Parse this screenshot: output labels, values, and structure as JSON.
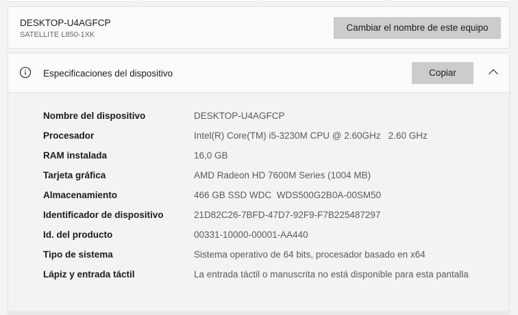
{
  "device": {
    "name": "DESKTOP-U4AGFCP",
    "model": "SATELLITE L850-1XK",
    "rename_label": "Cambiar el nombre de este equipo"
  },
  "specs": {
    "title": "Especificaciones del dispositivo",
    "copy_label": "Copiar",
    "info_icon": "info-icon",
    "collapse_icon": "chevron-up-icon",
    "rows": [
      {
        "label": "Nombre del dispositivo",
        "value": "DESKTOP-U4AGFCP"
      },
      {
        "label": "Procesador",
        "value": "Intel(R) Core(TM) i5-3230M CPU @ 2.60GHz   2.60 GHz"
      },
      {
        "label": "RAM instalada",
        "value": "16,0 GB"
      },
      {
        "label": "Tarjeta gráfica",
        "value": "AMD Radeon HD 7600M Series (1004 MB)"
      },
      {
        "label": "Almacenamiento",
        "value": "466 GB SSD WDC  WDS500G2B0A-00SM50"
      },
      {
        "label": "Identificador de dispositivo",
        "value": "21D82C26-7BFD-47D7-92F9-F7B225487297"
      },
      {
        "label": "Id. del producto",
        "value": "00331-10000-00001-AA440"
      },
      {
        "label": "Tipo de sistema",
        "value": "Sistema operativo de 64 bits, procesador basado en x64"
      },
      {
        "label": "Lápiz y entrada táctil",
        "value": "La entrada táctil o manuscrita no está disponible para esta pantalla"
      }
    ]
  }
}
